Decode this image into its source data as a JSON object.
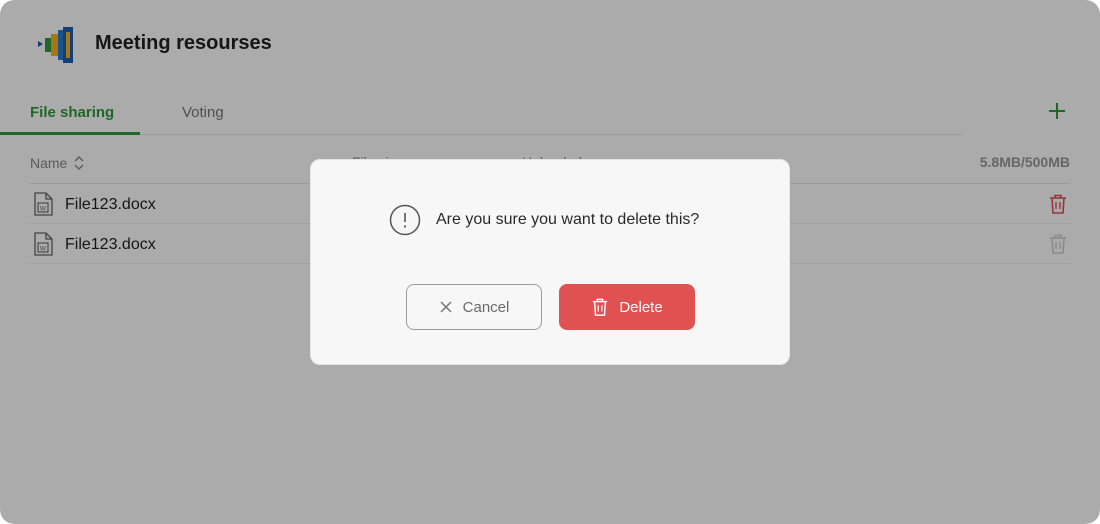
{
  "header": {
    "title": "Meeting resourses",
    "logo_icon": "meeting-logo-icon"
  },
  "tabs": [
    {
      "label": "File sharing",
      "active": true
    },
    {
      "label": "Voting",
      "active": false
    }
  ],
  "add_icon": "plus-icon",
  "table": {
    "columns": {
      "name": "Name",
      "size": "File size",
      "uploaded": "Uploaded"
    },
    "storage_usage": "5.8MB/500MB",
    "rows": [
      {
        "name": "File123.docx",
        "icon": "word-file-icon"
      },
      {
        "name": "File123.docx",
        "icon": "word-file-icon"
      }
    ]
  },
  "dialog": {
    "message": "Are you sure you want to delete this?",
    "cancel_label": "Cancel",
    "delete_label": "Delete"
  },
  "colors": {
    "accent": "#2f9a3c",
    "danger": "#e05252",
    "overlay": "rgba(0,0,0,0.33)"
  }
}
